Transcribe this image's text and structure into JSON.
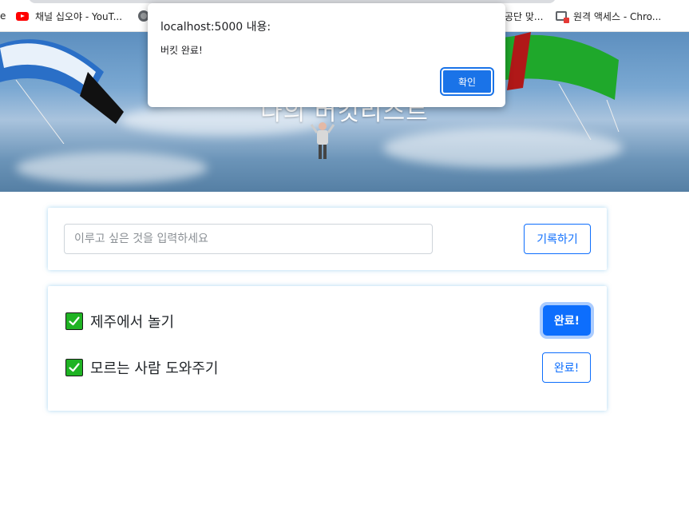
{
  "bookmarks": [
    {
      "label": "e",
      "icon": "none"
    },
    {
      "label": "채널 십오야 - YouT...",
      "icon": "youtube-icon"
    },
    {
      "label": "",
      "icon": "globe-icon"
    },
    {
      "label": "공단 맞...",
      "icon": "none"
    },
    {
      "label": "원격 액세스 - Chro...",
      "icon": "remote-desktop-icon"
    }
  ],
  "hero": {
    "title": "나의 버킷리스트"
  },
  "alert": {
    "title": "localhost:5000 내용:",
    "message": "버킷 완료!",
    "ok_label": "확인"
  },
  "form": {
    "placeholder": "이루고 싶은 것을 입력하세요",
    "value": "",
    "submit_label": "기록하기"
  },
  "buckets": [
    {
      "text": "제주에서 놀기",
      "done": true,
      "button_label": "완료!"
    },
    {
      "text": "모르는 사람 도와주기",
      "done": true,
      "button_label": "완료!"
    }
  ],
  "colors": {
    "primary": "#0d6efd",
    "check_green": "#1fb323",
    "dialog_button": "#1a73e8"
  }
}
